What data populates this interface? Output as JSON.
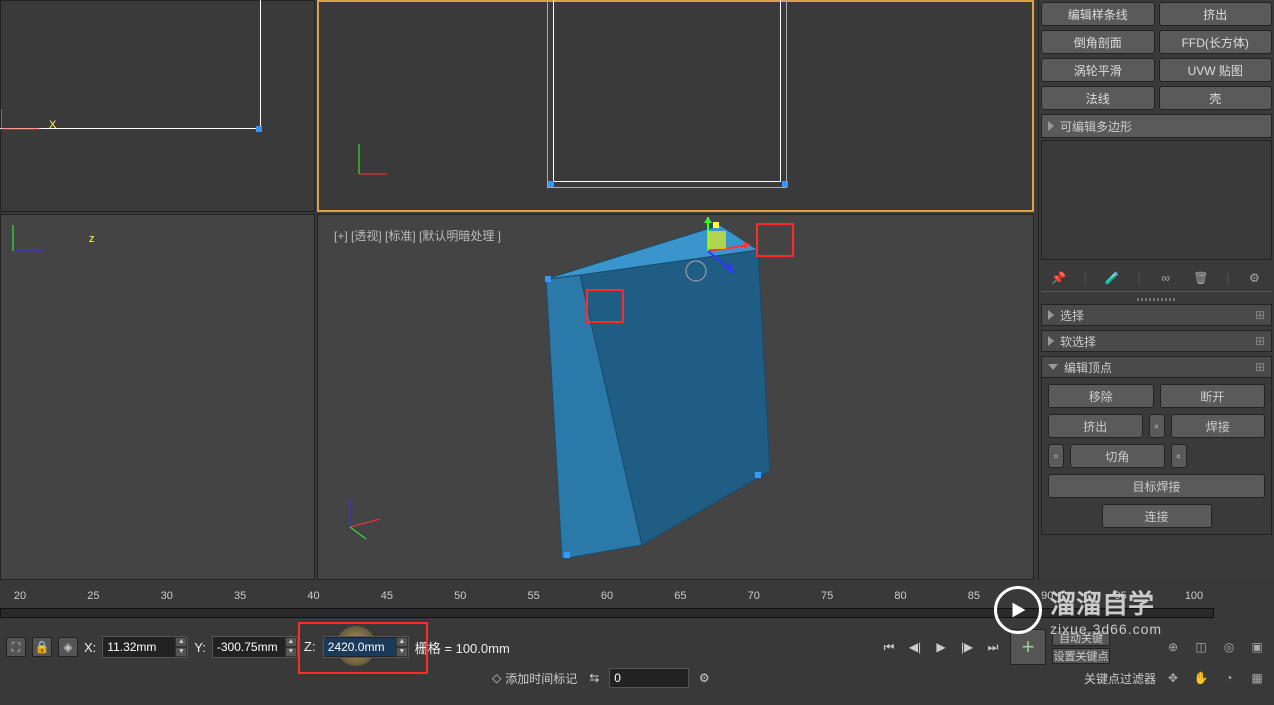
{
  "modifiers": {
    "btn1": "编辑样条线",
    "btn2": "挤出",
    "btn3": "倒角剖面",
    "btn4": "FFD(长方体)",
    "btn5": "涡轮平滑",
    "btn6": "UVW 贴图",
    "btn7": "法线",
    "btn8": "壳"
  },
  "stack": {
    "current": "可编辑多边形"
  },
  "tools": {
    "pin": "📌",
    "vial": "🧪",
    "link": "∞",
    "trash": "🗑",
    "cfg": "⚙"
  },
  "rollouts": {
    "r1": "选择",
    "r2": "软选择",
    "r3": "编辑顶点",
    "r3_btns": {
      "remove": "移除",
      "break": "断开",
      "extrude": "挤出",
      "weld": "焊接",
      "chamfer": "切角",
      "target": "目标焊接",
      "connect": "连接"
    }
  },
  "viewport": {
    "persp_label": "[+] [透视] [标准] [默认明暗处理 ]"
  },
  "timeline": {
    "ticks": [
      "20",
      "25",
      "30",
      "35",
      "40",
      "45",
      "50",
      "55",
      "60",
      "65",
      "70",
      "75",
      "80",
      "85",
      "90",
      "95",
      "100"
    ]
  },
  "coords": {
    "x_label": "X:",
    "x": "11.32mm",
    "y_label": "Y:",
    "y": "-300.75mm",
    "z_label": "Z:",
    "z": "2420.0mm",
    "grid": "栅格 = 100.0mm"
  },
  "keys": {
    "auto": "自动关键",
    "set": "设置关键点",
    "filter": "关键点过滤器"
  },
  "bottom": {
    "add_time": "添加时间标记",
    "frame": "0"
  },
  "watermark": {
    "title": "溜溜自学",
    "url": "zixue.3d66.com"
  }
}
